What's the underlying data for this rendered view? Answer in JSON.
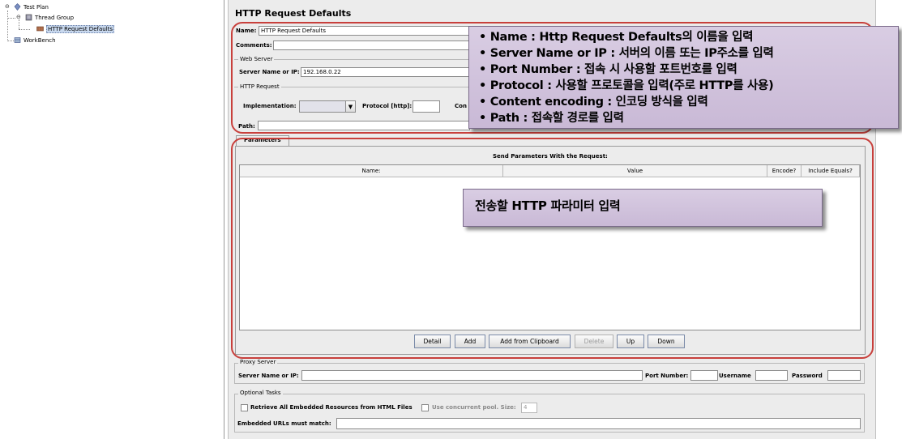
{
  "tree": {
    "items": [
      {
        "label": "Test Plan"
      },
      {
        "label": "Thread Group"
      },
      {
        "label": "HTTP Request Defaults"
      },
      {
        "label": "WorkBench"
      }
    ]
  },
  "panel": {
    "title": "HTTP Request Defaults",
    "name_label": "Name:",
    "name_value": "HTTP Request Defaults",
    "comments_label": "Comments:",
    "web_server_title": "Web Server",
    "server_label": "Server Name or IP:",
    "server_value": "192.168.0.22",
    "http_request_title": "HTTP Request",
    "implementation_label": "Implementation:",
    "protocol_label": "Protocol [http]:",
    "content_label_partial": "Con",
    "path_label": "Path:"
  },
  "parameters": {
    "tab_label": "Parameters",
    "table_title": "Send Parameters With the Request:",
    "columns": [
      "Name:",
      "Value",
      "Encode?",
      "Include Equals?"
    ],
    "buttons": {
      "detail": "Detail",
      "add": "Add",
      "add_clipboard": "Add from Clipboard",
      "delete": "Delete",
      "up": "Up",
      "down": "Down"
    }
  },
  "proxy": {
    "title": "Proxy Server",
    "server_label": "Server Name or IP:",
    "port_label": "Port Number:",
    "username_label": "Username",
    "password_label": "Password"
  },
  "optional": {
    "title": "Optional Tasks",
    "retrieve_label": "Retrieve All Embedded Resources from HTML Files",
    "concurrent_label": "Use concurrent pool. Size:",
    "pool_size": "4",
    "embedded_label": "Embedded URLs must match:"
  },
  "callouts": {
    "top_lines": [
      "• Name : Http Request Defaults의 이름을 입력",
      "• Server Name or IP : 서버의 이름 또는 IP주소를 입력",
      "• Port Number : 접속 시 사용할 포트번호를 입력",
      "• Protocol : 사용할 프로토콜을 입력(주로 HTTP를 사용)",
      "• Content encoding : 인코딩 방식을 입력",
      "• Path : 접속할 경로를 입력"
    ],
    "params_text": "전송할 HTTP 파라미터 입력"
  },
  "colors": {
    "highlight_border": "#c8403c",
    "callout_bg": "#d2c4de"
  }
}
